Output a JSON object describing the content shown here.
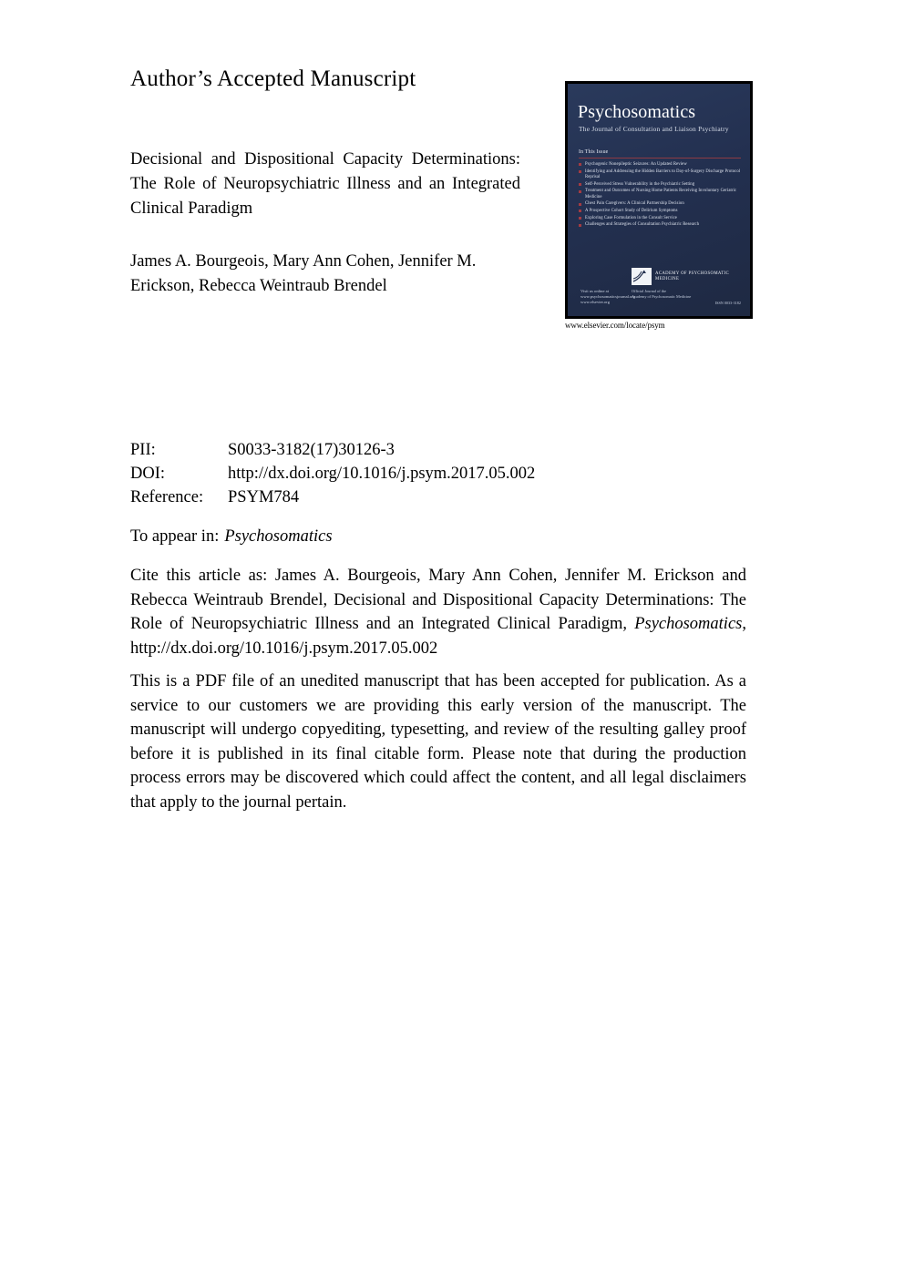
{
  "header": {
    "aam_label": "Author’s Accepted Manuscript"
  },
  "article": {
    "title": "Decisional and Dispositional Capacity Determinations: The Role of Neuropsychiatric Illness and an Integrated Clinical Paradigm",
    "authors": "James A. Bourgeois, Mary Ann Cohen, Jennifer M. Erickson, Rebecca Weintraub Brendel"
  },
  "cover": {
    "title": "Psychosomatics",
    "subtitle": "The Journal of Consultation and Liaison Psychiatry",
    "issue_label": "In This Issue",
    "issue_items": [
      "Psychogenic Nonepileptic Seizures: An Updated Review",
      "Identifying and Addressing the Hidden Barriers to Day-of-Surgery Discharge Protocol Reprisal",
      "Self-Perceived Stress Vulnerability in the Psychiatric Setting",
      "Treatment and Outcomes of Nursing Home Patients Receiving Involuntary Geriatric Medicine",
      "Chest Pain Caregivers: A Clinical Partnership Decision",
      "A Prospective Cohort Study of Delirium Symptoms",
      "Exploring Case Formulation in the Consult Service",
      "Challenges and Strategies of Consultation Psychiatric Research"
    ],
    "online_text": "Visit us online at\nwww.psychosomaticsjournal.org\nwww.elsevier.org",
    "apm_name": "ACADEMY OF PSYCHOSOMATIC MEDICINE",
    "apm_sub": "Official Journal of the\nAcademy of Psychosomatic Medicine",
    "apm_issn": "ISSN 0033-3182",
    "url_caption": "www.elsevier.com/locate/psym",
    "background_color": "#24304e",
    "accent_color": "#a33b42"
  },
  "meta": {
    "rows": [
      {
        "key": "PII:",
        "value": "S0033-3182(17)30126-3"
      },
      {
        "key": "DOI:",
        "value": "http://dx.doi.org/10.1016/j.psym.2017.05.002"
      },
      {
        "key": "Reference:",
        "value": "PSYM784"
      }
    ]
  },
  "appear": {
    "label": "To appear in:",
    "journal": "Psychosomatics"
  },
  "citation": {
    "lead": "Cite this article as: James A. Bourgeois, Mary Ann Cohen, Jennifer M. Erickson and Rebecca Weintraub Brendel, Decisional and Dispositional Capacity Determinations: The Role of Neuropsychiatric Illness and an Integrated Clinical Paradigm, ",
    "journal": "Psychosomatics",
    "tail": ", http://dx.doi.org/10.1016/j.psym.2017.05.002"
  },
  "disclaimer": {
    "text": "This is a PDF file of an unedited manuscript that has been accepted for publication. As a service to our customers we are providing this early version of the manuscript. The manuscript will undergo copyediting, typesetting, and review of the resulting galley proof before it is published in its final citable form. Please note that during the production process errors may be discovered which could affect the content, and all legal disclaimers that apply to the journal pertain."
  }
}
